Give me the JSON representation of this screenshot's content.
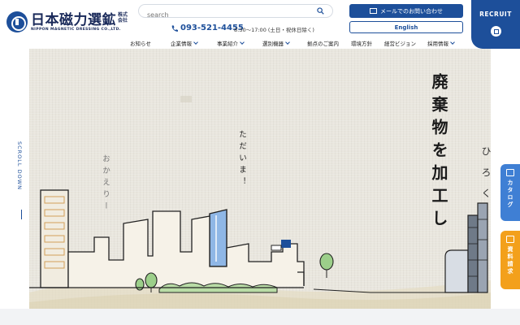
{
  "brand": {
    "name_jp": "日本磁力選鉱",
    "kabushiki": "株式会社",
    "name_en": "NIPPON MAGNETIC DRESSING CO.,LTD."
  },
  "search": {
    "placeholder": "search"
  },
  "contact": {
    "phone": "093-521-4455",
    "hours": "8:30〜17:00 (土日・祝休日除く)"
  },
  "buttons": {
    "mail": "メールでのお問い合わせ",
    "english": "English",
    "recruit": "RECRUIT"
  },
  "nav": {
    "items": [
      {
        "label": "お知らせ",
        "dropdown": false
      },
      {
        "label": "企業情報",
        "dropdown": true
      },
      {
        "label": "事業紹介",
        "dropdown": true
      },
      {
        "label": "選別機器",
        "dropdown": true
      },
      {
        "label": "拠点のご案内",
        "dropdown": false
      },
      {
        "label": "環境方針",
        "dropdown": false
      },
      {
        "label": "経営ビジョン",
        "dropdown": false
      },
      {
        "label": "採用情報",
        "dropdown": true
      }
    ]
  },
  "hero": {
    "headline": "廃棄物を加工し",
    "sub_right": "ひ ろ く",
    "tadaima": "ただいま！",
    "okaeri": "おかえりー"
  },
  "scroll_label": "SCROLL DOWN",
  "side_tabs": {
    "catalog": "カタログ",
    "request": "資料請求"
  },
  "colors": {
    "brand_blue": "#1d4f9a",
    "catalog_blue": "#3f7fd4",
    "request_orange": "#f3a01b",
    "hero_bg": "#e9e6de"
  }
}
